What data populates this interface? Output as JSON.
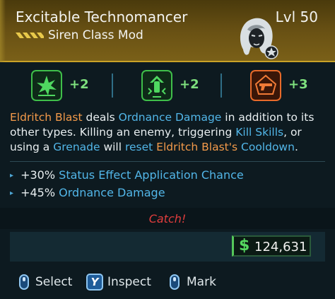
{
  "item": {
    "name": "Excitable Technomancer",
    "level": "Lvl 50",
    "type": "Siren Class Mod",
    "rarity_color": "#e8c84a"
  },
  "skills": [
    {
      "icon": "green-burst-skill-icon",
      "bonus": "+2",
      "color": "#3fbf4a"
    },
    {
      "icon": "green-chevron-skill-icon",
      "bonus": "+2",
      "color": "#3fbf4a"
    },
    {
      "icon": "orange-gun-skill-icon",
      "bonus": "+3",
      "color": "#e86a2a"
    }
  ],
  "description": {
    "segments": [
      {
        "text": "Eldritch Blast",
        "style": "orange"
      },
      {
        "text": " deals ",
        "style": "plain"
      },
      {
        "text": "Ordnance Damage",
        "style": "blue"
      },
      {
        "text": " in addition to its other types. Killing an enemy, triggering ",
        "style": "plain"
      },
      {
        "text": "Kill Skills",
        "style": "blue"
      },
      {
        "text": ", or using a ",
        "style": "plain"
      },
      {
        "text": "Grenade",
        "style": "blue"
      },
      {
        "text": " will ",
        "style": "plain"
      },
      {
        "text": "reset",
        "style": "blue"
      },
      {
        "text": " ",
        "style": "plain"
      },
      {
        "text": "Eldritch Blast's",
        "style": "orange"
      },
      {
        "text": " ",
        "style": "plain"
      },
      {
        "text": "Cooldown",
        "style": "blue"
      },
      {
        "text": ".",
        "style": "plain"
      }
    ]
  },
  "stats": [
    {
      "value": "+30%",
      "name": "Status Effect Application Chance"
    },
    {
      "value": "+45%",
      "name": "Ordnance Damage"
    }
  ],
  "flavor_text": "Catch!",
  "price": {
    "symbol": "$",
    "amount": "124,631"
  },
  "actions": [
    {
      "key": "",
      "label": "Select"
    },
    {
      "key": "Y",
      "label": "Inspect"
    },
    {
      "key": "",
      "label": "Mark"
    }
  ]
}
